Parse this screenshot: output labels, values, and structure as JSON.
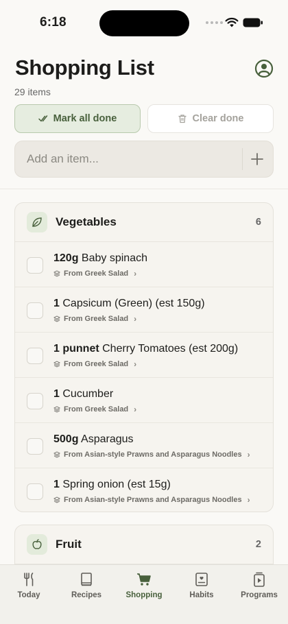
{
  "status_bar": {
    "time": "6:18"
  },
  "header": {
    "title": "Shopping List",
    "item_count": "29 items"
  },
  "actions": {
    "mark_all_done": "Mark all done",
    "clear_done": "Clear done"
  },
  "add_item": {
    "placeholder": "Add an item..."
  },
  "categories": [
    {
      "name": "Vegetables",
      "count": "6",
      "icon": "leaf-icon",
      "items": [
        {
          "qty": "120g",
          "name": "Baby spinach",
          "source": "From Greek Salad"
        },
        {
          "qty": "1",
          "name": "Capsicum (Green) (est 150g)",
          "source": "From Greek Salad"
        },
        {
          "qty": "1 punnet",
          "name": "Cherry Tomatoes (est 200g)",
          "source": "From Greek Salad"
        },
        {
          "qty": "1",
          "name": "Cucumber",
          "source": "From Greek Salad"
        },
        {
          "qty": "500g",
          "name": "Asparagus",
          "source": "From Asian-style Prawns and Asparagus Noodles"
        },
        {
          "qty": "1",
          "name": "Spring onion (est 15g)",
          "source": "From Asian-style Prawns and Asparagus Noodles"
        }
      ]
    },
    {
      "name": "Fruit",
      "count": "2",
      "icon": "apple-icon"
    }
  ],
  "tabs": [
    {
      "label": "Today",
      "icon": "fork-knife-icon",
      "active": false
    },
    {
      "label": "Recipes",
      "icon": "book-icon",
      "active": false
    },
    {
      "label": "Shopping",
      "icon": "cart-icon",
      "active": true
    },
    {
      "label": "Habits",
      "icon": "journal-icon",
      "active": false
    },
    {
      "label": "Programs",
      "icon": "program-icon",
      "active": false
    }
  ],
  "colors": {
    "accent": "#48603c",
    "accent_bg": "#e6ede0",
    "background": "#faf9f6"
  }
}
